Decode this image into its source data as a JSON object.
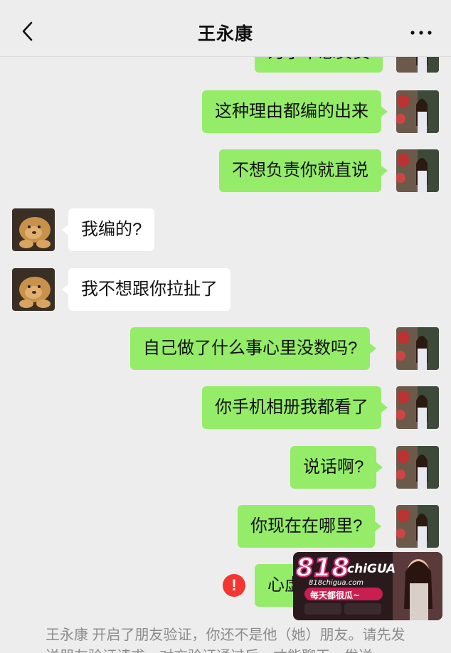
{
  "header": {
    "title": "王永康"
  },
  "messages": [
    {
      "sender": "me",
      "text": "为了不想负责"
    },
    {
      "sender": "me",
      "text": "这种理由都编的出来"
    },
    {
      "sender": "me",
      "text": "不想负责你就直说"
    },
    {
      "sender": "other",
      "text": "我编的?"
    },
    {
      "sender": "other",
      "text": "我不想跟你拉扯了"
    },
    {
      "sender": "me",
      "text": "自己做了什么事心里没数吗?"
    },
    {
      "sender": "me",
      "text": "你手机相册我都看了"
    },
    {
      "sender": "me",
      "text": "说话啊?"
    },
    {
      "sender": "me",
      "text": "你现在在哪里?"
    },
    {
      "sender": "me",
      "text": "心虚",
      "status": "failed"
    }
  ],
  "status_icons": {
    "failed": "!"
  },
  "system_notice": {
    "text": "王永康 开启了朋友验证，你还不是他（她）朋友。请先发送朋友验证请求，对方验证通过后，才能聊天。发送"
  },
  "watermark": {
    "brand": "818",
    "brand_suffix": "chiGUA",
    "site": "818chigua.com",
    "slogan": "每天都很瓜~"
  },
  "colors": {
    "my_bubble": "#95ec69",
    "other_bubble": "#ffffff",
    "background": "#ededed",
    "error": "#f43530"
  }
}
